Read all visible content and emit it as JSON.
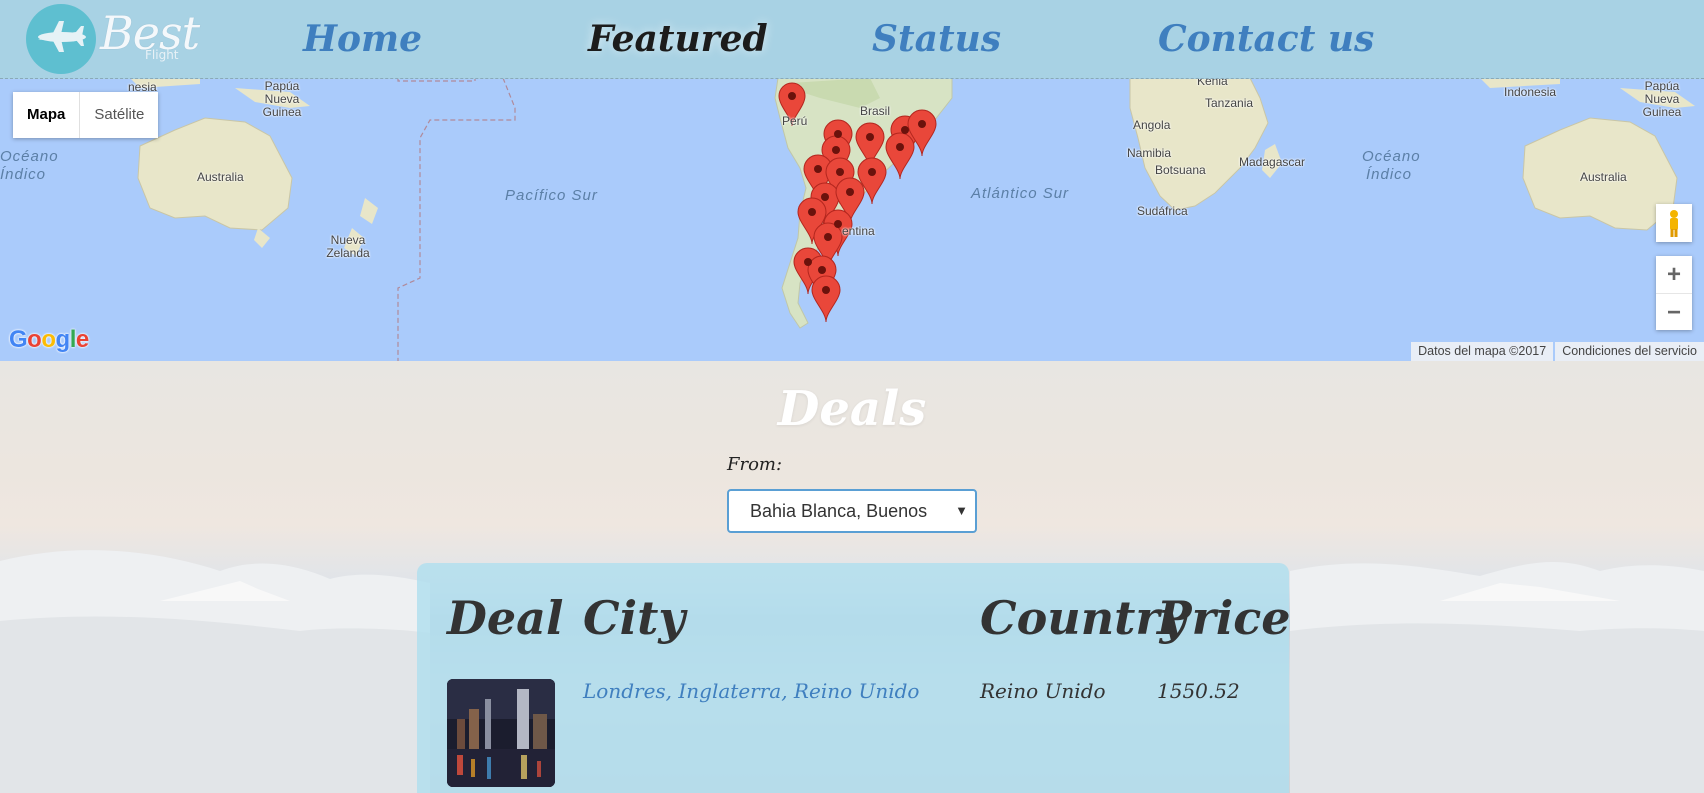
{
  "nav": {
    "logo_text": "Best",
    "logo_sub": "Flight",
    "links": [
      {
        "label": "Home"
      },
      {
        "label": "Featured"
      },
      {
        "label": "Status"
      },
      {
        "label": "Contact us"
      }
    ],
    "active": "Featured"
  },
  "map": {
    "type_buttons": [
      "Mapa",
      "Satélite"
    ],
    "selected_type": "Mapa",
    "zoom_in": "+",
    "zoom_out": "−",
    "logo": "Google",
    "attribution": [
      "Datos del mapa ©2017",
      "Condiciones del servicio"
    ],
    "labels": {
      "indonesia_left": "nesia",
      "papua_left": "Papúa Nueva Guinea",
      "oceano_indico_left_1": "Océano",
      "oceano_indico_left_2": "Índico",
      "australia_left": "Australia",
      "nueva_zelanda": "Nueva Zelanda",
      "pacifico_sur": "Pacífico Sur",
      "peru": "Perú",
      "brasil": "Brasil",
      "argentina": "entina",
      "atlantico_sur": "Atlántico Sur",
      "tanzania": "Tanzania",
      "angola": "Angola",
      "namibia": "Namibia",
      "botsuana": "Botsuana",
      "madagascar": "Madagascar",
      "sudafrica": "Sudáfrica",
      "oceano_indico_right_1": "Océano",
      "oceano_indico_right_2": "Índico",
      "indonesia_right": "Indonesia",
      "papua_right": "Papúa Nueva Guinea",
      "australia_right": "Australia",
      "kenia": "Kenia"
    },
    "marker_color": "#e9473a"
  },
  "deals": {
    "title": "Deals",
    "from_label": "From:",
    "from_value": "Bahia Blanca, Buenos",
    "columns": [
      "Deal",
      "City",
      "Country",
      "Price"
    ],
    "rows": [
      {
        "city": "Londres, Inglaterra, Reino Unido",
        "country": "Reino Unido",
        "price": "1550.52"
      }
    ]
  }
}
